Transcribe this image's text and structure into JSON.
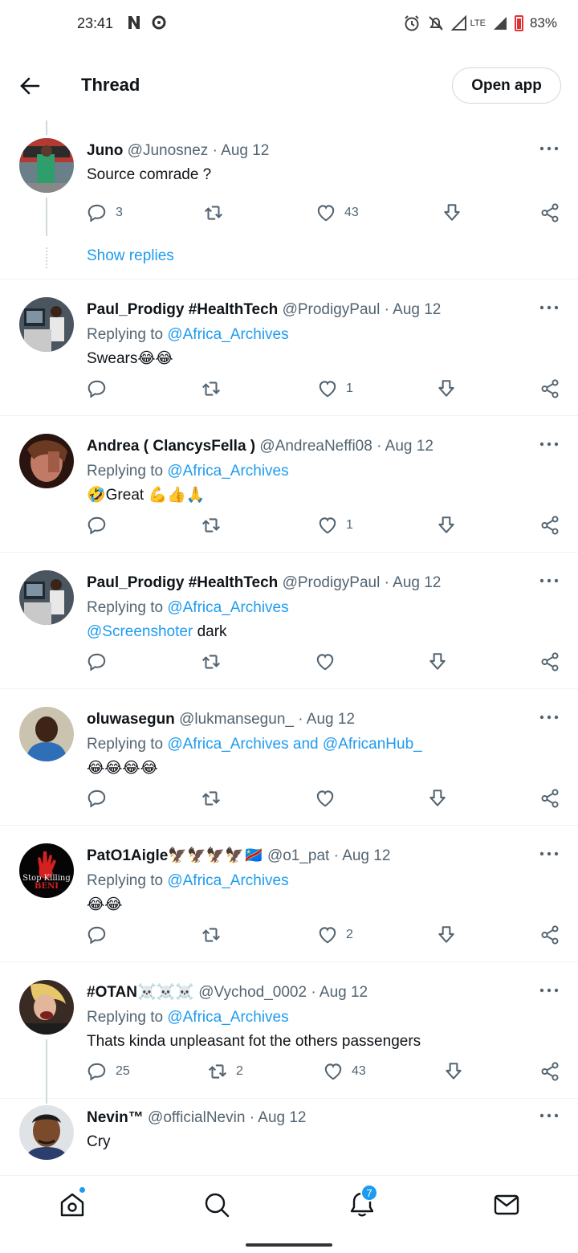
{
  "status_bar": {
    "time": "23:41",
    "battery": "83%",
    "network": "LTE"
  },
  "header": {
    "title": "Thread",
    "open_app": "Open app"
  },
  "tweets": [
    {
      "name": "Juno",
      "handle": "@Junosnez",
      "date": "Aug 12",
      "reply_to": "",
      "text": "Source comrade ?",
      "replies": "3",
      "retweets": "",
      "likes": "43",
      "show_replies": "Show replies"
    },
    {
      "name": "Paul_Prodigy #HealthTech",
      "handle": "@ProdigyPaul",
      "date": "Aug 12",
      "reply_to": "@Africa_Archives",
      "text": "Swears😂😂",
      "replies": "",
      "retweets": "",
      "likes": "1"
    },
    {
      "name": "Andrea ( ClancysFella )",
      "handle": "@AndreaNeffi08",
      "date": "Aug 12",
      "reply_to": "@Africa_Archives",
      "text": "🤣Great 💪👍🙏",
      "replies": "",
      "retweets": "",
      "likes": "1"
    },
    {
      "name": "Paul_Prodigy #HealthTech",
      "handle": "@ProdigyPaul",
      "date": "Aug 12",
      "reply_to": "@Africa_Archives",
      "text_link": "@Screenshoter",
      "text": " dark",
      "replies": "",
      "retweets": "",
      "likes": ""
    },
    {
      "name": "oluwasegun",
      "handle": "@lukmansegun_",
      "date": "Aug 12",
      "reply_to": "@Africa_Archives and @AfricanHub_",
      "text": "😂😂😂😂",
      "replies": "",
      "retweets": "",
      "likes": ""
    },
    {
      "name": "PatO1Aigle🦅🦅🦅🦅🇨🇩",
      "handle": "@o1_pat",
      "date": "Aug 12",
      "reply_to": "@Africa_Archives",
      "text": "😂😂",
      "replies": "",
      "retweets": "",
      "likes": "2"
    },
    {
      "name": "#OTAN☠️☠️☠️",
      "handle": "@Vychod_0002",
      "date": "Aug 12",
      "reply_to": "@Africa_Archives",
      "text": "Thats kinda unpleasant fot the others passengers",
      "replies": "25",
      "retweets": "2",
      "likes": "43"
    },
    {
      "name": "Nevin™",
      "handle": "@officialNevin",
      "date": "Aug 12",
      "reply_to": "",
      "text": "Cry",
      "replies": "",
      "retweets": "",
      "likes": ""
    }
  ],
  "reply_prefix": "Replying to ",
  "avatar_text": {
    "stop": "Stop Killing",
    "beni": "BENI"
  },
  "nav": {
    "notifications_badge": "7"
  },
  "colors": {
    "accent": "#1d9bf0",
    "text": "#0f1419",
    "muted": "#536471"
  }
}
